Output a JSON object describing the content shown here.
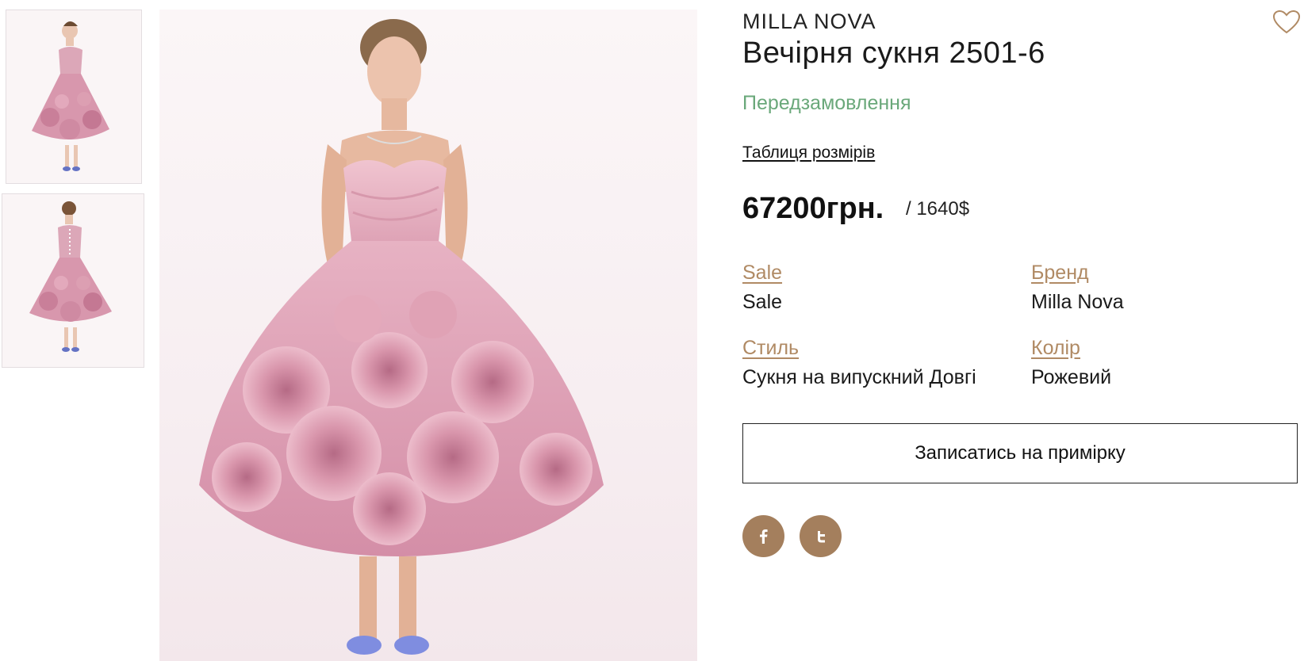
{
  "product": {
    "brand": "MILLA NOVA",
    "title": "Вечірня сукня 2501-6",
    "status": "Передзамовлення",
    "size_table_link": "Таблиця розмірів",
    "price": "67200грн.",
    "price_usd": "/ 1640$"
  },
  "attributes": [
    {
      "label": "Sale",
      "value": "Sale"
    },
    {
      "label": "Бренд",
      "value": "Milla Nova"
    },
    {
      "label": "Стиль",
      "value": "Сукня на випускний Довгі"
    },
    {
      "label": "Колір",
      "value": "Рожевий"
    }
  ],
  "actions": {
    "fitting_button": "Записатись на примірку"
  },
  "icons": {
    "wishlist": "heart-icon",
    "facebook": "facebook-icon",
    "twitter": "twitter-icon"
  },
  "colors": {
    "accent": "#a47f5d",
    "link": "#b08a64",
    "status": "#6aa87a",
    "dress": "#d99aae"
  }
}
